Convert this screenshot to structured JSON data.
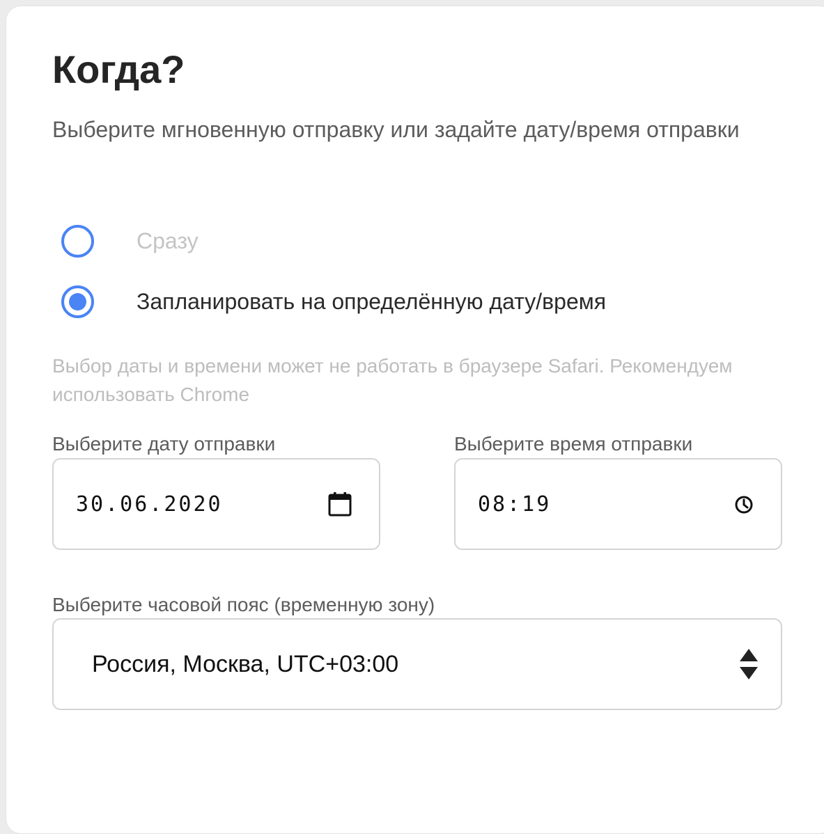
{
  "title": "Когда?",
  "subtitle": "Выберите мгновенную отправку или задайте дату/время отправки",
  "send_mode": {
    "options": [
      {
        "label": "Сразу",
        "checked": false
      },
      {
        "label": "Запланировать на определённую дату/время",
        "checked": true
      }
    ]
  },
  "browser_note": "Выбор даты и времени может не работать в браузере Safari. Рекомендуем использовать Chrome",
  "date_field": {
    "label": "Выберите дату отправки",
    "value": "30.06.2020",
    "icon": "calendar-icon"
  },
  "time_field": {
    "label": "Выберите время отправки",
    "value": "08:19",
    "icon": "clock-icon"
  },
  "timezone_field": {
    "label": "Выберите часовой пояс (временную зону)",
    "value": "Россия, Москва, UTC+03:00",
    "icon": "sort-arrows-icon"
  },
  "colors": {
    "accent": "#4a84f5",
    "title": "#252525",
    "muted_text": "#bdbdbd",
    "border": "#d4d4d4"
  }
}
